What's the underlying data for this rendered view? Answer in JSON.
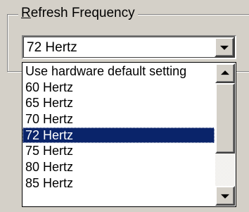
{
  "group": {
    "accel": "R",
    "label_rest": "efresh Frequency"
  },
  "combo": {
    "selected_value": "72 Hertz"
  },
  "dropdown": {
    "items": [
      "Use hardware default setting",
      "60 Hertz",
      "65 Hertz",
      "70 Hertz",
      "72 Hertz",
      "75 Hertz",
      "80 Hertz",
      "85 Hertz"
    ],
    "selected_index": 4,
    "scroll_position": 0.0
  },
  "icons": {
    "combo_button": "chevron-down-icon",
    "scroll_up": "scroll-up-arrow-icon",
    "scroll_down": "scroll-down-arrow-icon"
  },
  "colors": {
    "selection_background": "#0a246a",
    "selection_text": "#ffffff",
    "face": "#d4d0c8"
  }
}
